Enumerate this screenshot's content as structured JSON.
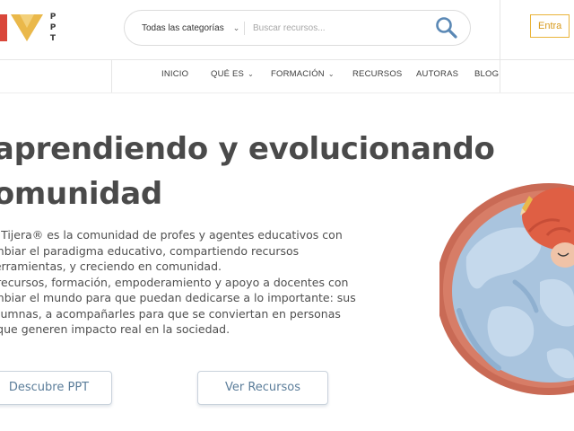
{
  "header": {
    "logo_letters": [
      "P",
      "P",
      "T"
    ],
    "search": {
      "category_label": "Todas las categorías",
      "placeholder": "Buscar recursos..."
    },
    "login_label": "Entra"
  },
  "nav": {
    "items": [
      {
        "label": "INICIO",
        "dropdown": false
      },
      {
        "label": "QUÉ ES",
        "dropdown": true
      },
      {
        "label": "FORMACIÓN",
        "dropdown": true
      },
      {
        "label": "RECURSOS",
        "dropdown": false
      },
      {
        "label": "AUTORAS",
        "dropdown": false
      },
      {
        "label": "BLOG",
        "dropdown": false
      }
    ]
  },
  "hero": {
    "title_line1": "saprendiendo y evolucionando",
    "title_line2": "comunidad",
    "paragraph_lines": [
      "pel Tijera® es la comunidad de profes y agentes educativos con",
      "cambiar el paradigma educativo, compartiendo recursos",
      ", herramientas, y creciendo en comunidad.",
      "os recursos, formación, empoderamiento y apoyo a docentes con",
      "cambiar el mundo para que puedan dedicarse a lo importante: sus",
      "y alumnas, a acompañarles para que se conviertan en personas",
      "es que generen impacto real en la sociedad."
    ],
    "buttons": {
      "discover_label": "Descubre PPT",
      "resources_label": "Ver Recursos"
    }
  },
  "colors": {
    "accent_yellow": "#e9b43a",
    "logo_red": "#d9473a",
    "button_text": "#5b7d9a",
    "earth_blue": "#a9c4de",
    "earth_rim": "#c96a55"
  },
  "icons": {
    "search": "magnifier-icon",
    "chevron": "chevron-down-icon"
  }
}
